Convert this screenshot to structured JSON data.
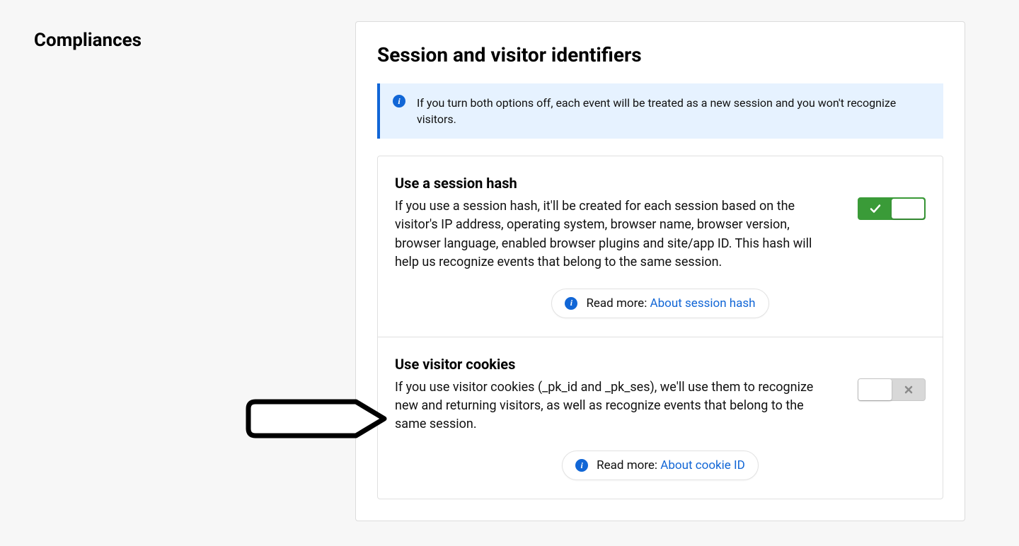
{
  "sidebar": {
    "title": "Compliances"
  },
  "panel": {
    "title": "Session and visitor identifiers",
    "banner": "If you turn both options off, each event will be treated as a new session and you won't recognize visitors."
  },
  "settings": {
    "sessionHash": {
      "title": "Use a session hash",
      "desc": "If you use a session hash, it'll be created for each session based on the visitor's IP address, operating system, browser name, browser version, browser language, enabled browser plugins and site/app ID. This hash will help us recognize events that belong to the same session.",
      "enabled": true,
      "readmore_label": "Read more: ",
      "readmore_link": "About session hash"
    },
    "visitorCookies": {
      "title": "Use visitor cookies",
      "desc": "If you use visitor cookies (_pk_id and _pk_ses), we'll use them to recognize new and returning visitors, as well as recognize events that belong to the same session.",
      "enabled": false,
      "readmore_label": "Read more: ",
      "readmore_link": "About cookie ID"
    }
  }
}
